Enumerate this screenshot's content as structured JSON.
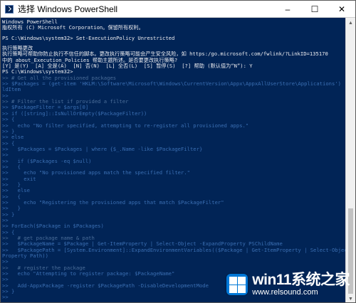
{
  "window": {
    "title": "选择 Windows PowerShell",
    "controls": {
      "minimize": "–",
      "maximize": "☐",
      "close": "✕"
    }
  },
  "console_lines": [
    {
      "text": "Windows PowerShell",
      "style": ""
    },
    {
      "text": "版权所有 (C) Microsoft Corporation。保留所有权利。",
      "style": ""
    },
    {
      "text": "",
      "style": "spacer"
    },
    {
      "text": "PS C:\\Windows\\system32> Set-ExecutionPolicy Unrestricted",
      "style": ""
    },
    {
      "text": "",
      "style": "spacer"
    },
    {
      "text": "执行策略更改",
      "style": ""
    },
    {
      "text": "执行策略可帮助你防止执行不信任的脚本。更改执行策略可能会产生安全风险，如 https:/go.microsoft.com/fwlink/?LinkID=135170",
      "style": ""
    },
    {
      "text": "中的 about_Execution_Policies 帮助主题所述。是否要更改执行策略?",
      "style": ""
    },
    {
      "text": "[Y] 是(Y)  [A] 全是(A)  [N] 否(N)  [L] 全否(L)  [S] 暂停(S)  [?] 帮助 (默认值为“N”): Y",
      "style": ""
    },
    {
      "text": "PS C:\\Windows\\system32>",
      "style": ""
    },
    {
      "text": ">> # Get all the provisioned packages",
      "style": "dim"
    },
    {
      "text": ">> $Packages = (get-item 'HKLM:\\Software\\Microsoft\\Windows\\CurrentVersion\\Appx\\AppxAllUserStore\\Applications') | Get-Chi",
      "style": "cont"
    },
    {
      "text": "ldItem",
      "style": "cont"
    },
    {
      "text": ">>",
      "style": "cont"
    },
    {
      "text": ">> # Filter the list if provided a filter",
      "style": "dim"
    },
    {
      "text": ">> $PackageFilter = $args[0]",
      "style": "cont"
    },
    {
      "text": ">> if ([string]::IsNullOrEmpty($PackageFilter))",
      "style": "cont"
    },
    {
      "text": ">> {",
      "style": "cont"
    },
    {
      "text": ">>   echo \"No filter specified, attempting to re-register all provisioned apps.\"",
      "style": "cont"
    },
    {
      "text": ">> }",
      "style": "cont"
    },
    {
      "text": ">> else",
      "style": "cont"
    },
    {
      "text": ">> {",
      "style": "cont"
    },
    {
      "text": ">>   $Packages = $Packages | where {$_.Name -like $PackageFilter}",
      "style": "cont"
    },
    {
      "text": ">>",
      "style": "cont"
    },
    {
      "text": ">>   if ($Packages -eq $null)",
      "style": "cont"
    },
    {
      "text": ">>   {",
      "style": "cont"
    },
    {
      "text": ">>     echo \"No provisioned apps match the specified filter.\"",
      "style": "cont"
    },
    {
      "text": ">>     exit",
      "style": "cont"
    },
    {
      "text": ">>   }",
      "style": "cont"
    },
    {
      "text": ">>   else",
      "style": "cont"
    },
    {
      "text": ">>   {",
      "style": "cont"
    },
    {
      "text": ">>     echo \"Registering the provisioned apps that match $PackageFilter\"",
      "style": "cont"
    },
    {
      "text": ">>   }",
      "style": "cont"
    },
    {
      "text": ">> }",
      "style": "cont"
    },
    {
      "text": ">>",
      "style": "cont"
    },
    {
      "text": ">> ForEach($Package in $Packages)",
      "style": "cont"
    },
    {
      "text": ">> {",
      "style": "cont"
    },
    {
      "text": ">>   # get package name & path",
      "style": "dim"
    },
    {
      "text": ">>   $PackageName = $Package | Get-ItemProperty | Select-Object -ExpandProperty PSChildName",
      "style": "cont"
    },
    {
      "text": ">>   $PackagePath = [System.Environment]::ExpandEnvironmentVariables(($Package | Get-ItemProperty | Select-Object -Expand",
      "style": "cont"
    },
    {
      "text": "Property Path))",
      "style": "cont"
    },
    {
      "text": ">>",
      "style": "cont"
    },
    {
      "text": ">>   # register the package",
      "style": "dim"
    },
    {
      "text": ">>   echo \"Attempting to register package: $PackageName\"",
      "style": "cont"
    },
    {
      "text": ">>",
      "style": "cont"
    },
    {
      "text": ">>   Add-AppxPackage -register $PackagePath -DisableDevelopmentMode",
      "style": "cont"
    },
    {
      "text": ">> }",
      "style": "cont"
    },
    {
      "text": ">>",
      "style": "cont"
    }
  ],
  "scrollbar": {
    "up_arrow": "▲",
    "down_arrow": "▼"
  },
  "watermark": {
    "main": "win11系统之家",
    "sub": "www.relsound.com"
  }
}
